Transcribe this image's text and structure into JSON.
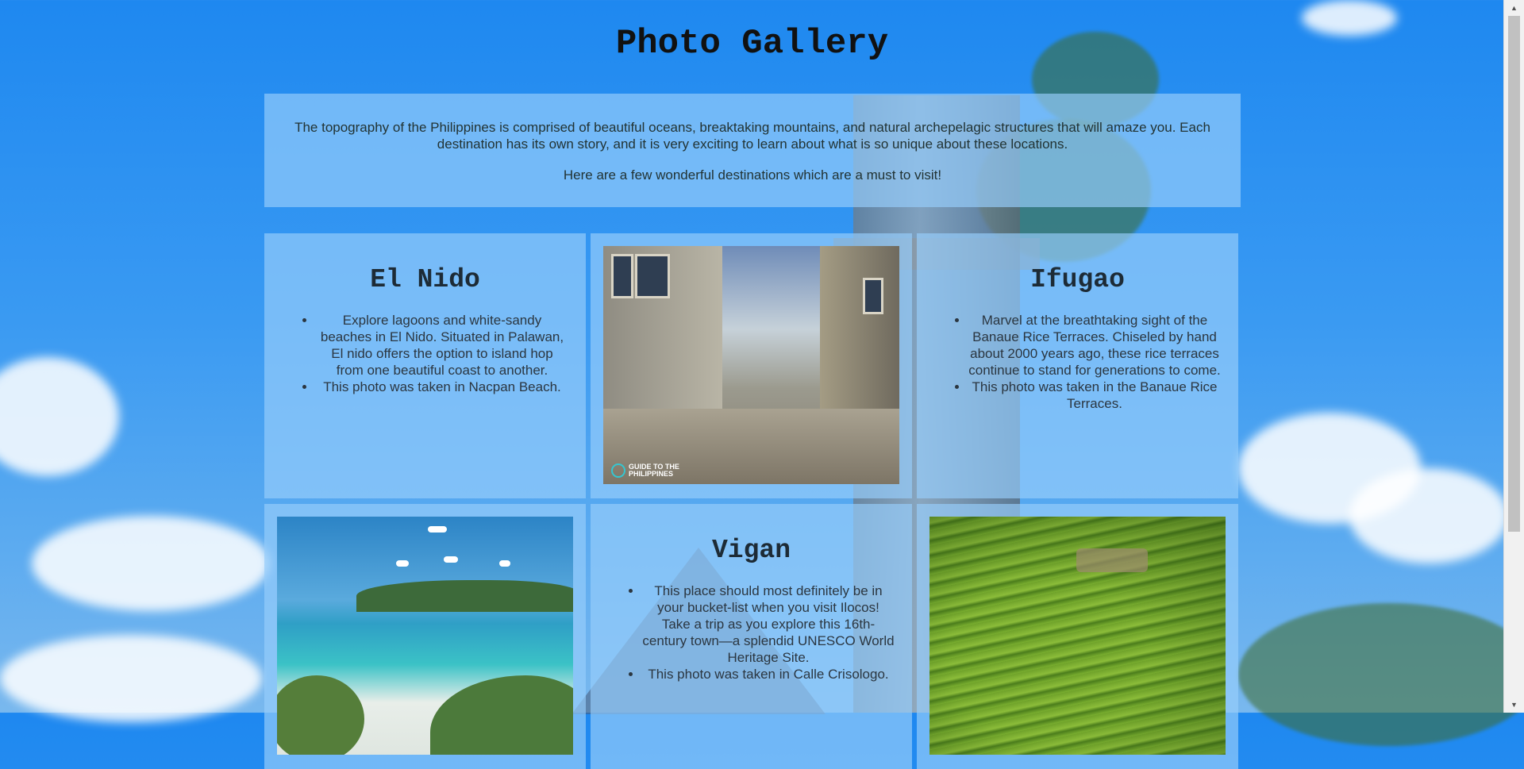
{
  "page": {
    "title": "Photo Gallery",
    "intro": [
      "The topography of the Philippines is comprised of beautiful oceans, breaktaking mountains, and natural archepelagic structures that will amaze you. Each destination has its own story, and it is very exciting to learn about what is so unique about these locations.",
      "Here are a few wonderful destinations which are a must to visit!"
    ]
  },
  "cards": {
    "el_nido": {
      "title": "El Nido",
      "items": [
        "Explore lagoons and white-sandy beaches in El Nido. Situated in Palawan, El nido offers the option to island hop from one beautiful coast to another.",
        "This photo was taken in Nacpan Beach."
      ]
    },
    "ifugao": {
      "title": "Ifugao",
      "items": [
        "Marvel at the breathtaking sight of the Banaue Rice Terraces. Chiseled by hand about 2000 years ago, these rice terraces continue to stand for generations to come.",
        "This photo was taken in the Banaue Rice Terraces."
      ]
    },
    "vigan": {
      "title": "Vigan",
      "items": [
        "This place should most definitely be in your bucket-list when you visit Ilocos! Take a trip as you explore this 16th-century town—a splendid UNESCO World Heritage Site.",
        "This photo was taken in Calle Crisologo."
      ]
    }
  },
  "photos": {
    "vigan_watermark": [
      "GUIDE TO THE",
      "PHILIPPINES"
    ]
  },
  "scrollbar": {
    "up_icon": "▲",
    "down_icon": "▼"
  },
  "colors": {
    "sky": "#1e88f0",
    "panel": "rgba(150,205,250,0.68)",
    "text": "#233"
  }
}
